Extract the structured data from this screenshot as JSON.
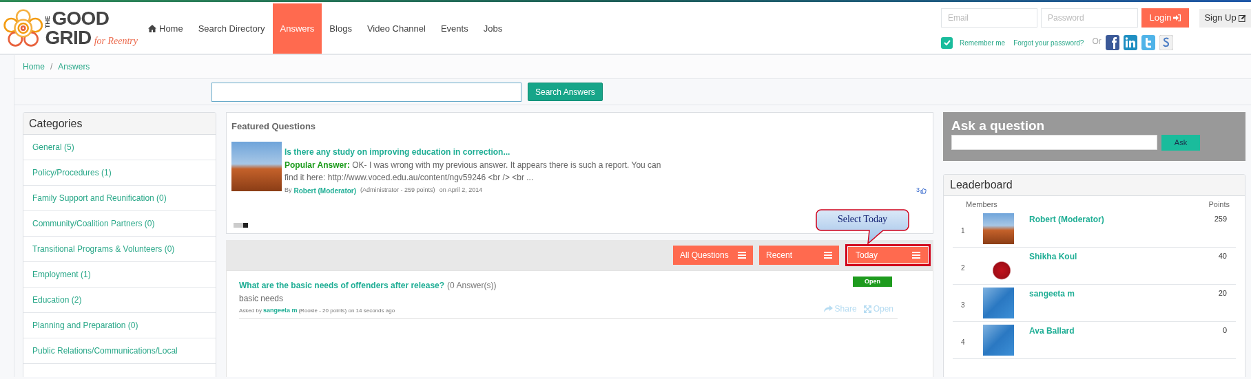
{
  "logo": {
    "small": "THE",
    "line_1": "GOOD",
    "line_2": "GRID",
    "tagline": "for Reentry"
  },
  "nav": [
    {
      "label": "Home",
      "has_icon": true,
      "selected": false
    },
    {
      "label": "Search Directory",
      "has_icon": false,
      "selected": false
    },
    {
      "label": "Answers",
      "has_icon": false,
      "selected": true
    },
    {
      "label": "Blogs",
      "has_icon": false,
      "selected": false
    },
    {
      "label": "Video Channel",
      "has_icon": false,
      "selected": false
    },
    {
      "label": "Events",
      "has_icon": false,
      "selected": false
    },
    {
      "label": "Jobs",
      "has_icon": false,
      "selected": false
    }
  ],
  "login": {
    "email_placeholder": "Email",
    "password_placeholder": "Password",
    "login_button": "Login",
    "signup_button": "Sign Up",
    "remember_me": {
      "label": "Remember me",
      "checked": true
    },
    "forgot_link": "Forgot your password?",
    "or_text": "Or"
  },
  "breadcrumb": {
    "items": [
      "Home",
      "Answers"
    ],
    "separator": "/"
  },
  "search": {
    "button": "Search Answers"
  },
  "categories": {
    "title": "Categories",
    "items": [
      "General (5)",
      "Policy/Procedures (1)",
      "Family Support and Reunification (0)",
      "Community/Coalition Partners (0)",
      "Transitional Programs & Volunteers (0)",
      "Employment (1)",
      "Education (2)",
      "Planning and Preparation (0)",
      "Public Relations/Communications/Local"
    ]
  },
  "featured": {
    "title": "Featured Questions",
    "question": {
      "title": "Is there any study on improving education in correction...",
      "answer_label": "Popular Answer:",
      "answer_text": "OK- I was wrong with my previous answer. It appears there is such a report. You can find it here: http://www.voced.edu.au/content/ngv59246 <br /> <br ...",
      "by": "By",
      "author": "Robert (Moderator)",
      "role": "(Administrator - 259 points)",
      "date": "on April 2, 2014",
      "likes": "3"
    },
    "pager": [
      {
        "selected": false
      },
      {
        "selected": false
      },
      {
        "selected": true
      }
    ]
  },
  "filters": [
    {
      "label": "All Questions",
      "highlighted": false
    },
    {
      "label": "Recent",
      "highlighted": false
    },
    {
      "label": "Today",
      "highlighted": true
    }
  ],
  "callout": {
    "text": "Select Today"
  },
  "questions": [
    {
      "title": "What are the basic needs of offenders after release?",
      "answers": "(0 Answer(s))",
      "excerpt": "basic needs",
      "asked_by": "Asked by",
      "author": "sangeeta m",
      "meta": "(Rookie - 20 points) on 14 seconds ago",
      "status": "Open",
      "share": "Share",
      "open": "Open"
    }
  ],
  "ask": {
    "title": "Ask a question",
    "button": "Ask"
  },
  "leaderboard": {
    "title": "Leaderboard",
    "col_members": "Members",
    "col_points": "Points",
    "rows": [
      {
        "rank": "1",
        "name": "Robert (Moderator)",
        "points": "259",
        "kind": "photo"
      },
      {
        "rank": "2",
        "name": "Shikha Koul",
        "points": "40",
        "kind": "flower"
      },
      {
        "rank": "3",
        "name": "sangeeta m",
        "points": "20",
        "kind": "default"
      },
      {
        "rank": "4",
        "name": "Ava Ballard",
        "points": "0",
        "kind": "default"
      }
    ]
  }
}
